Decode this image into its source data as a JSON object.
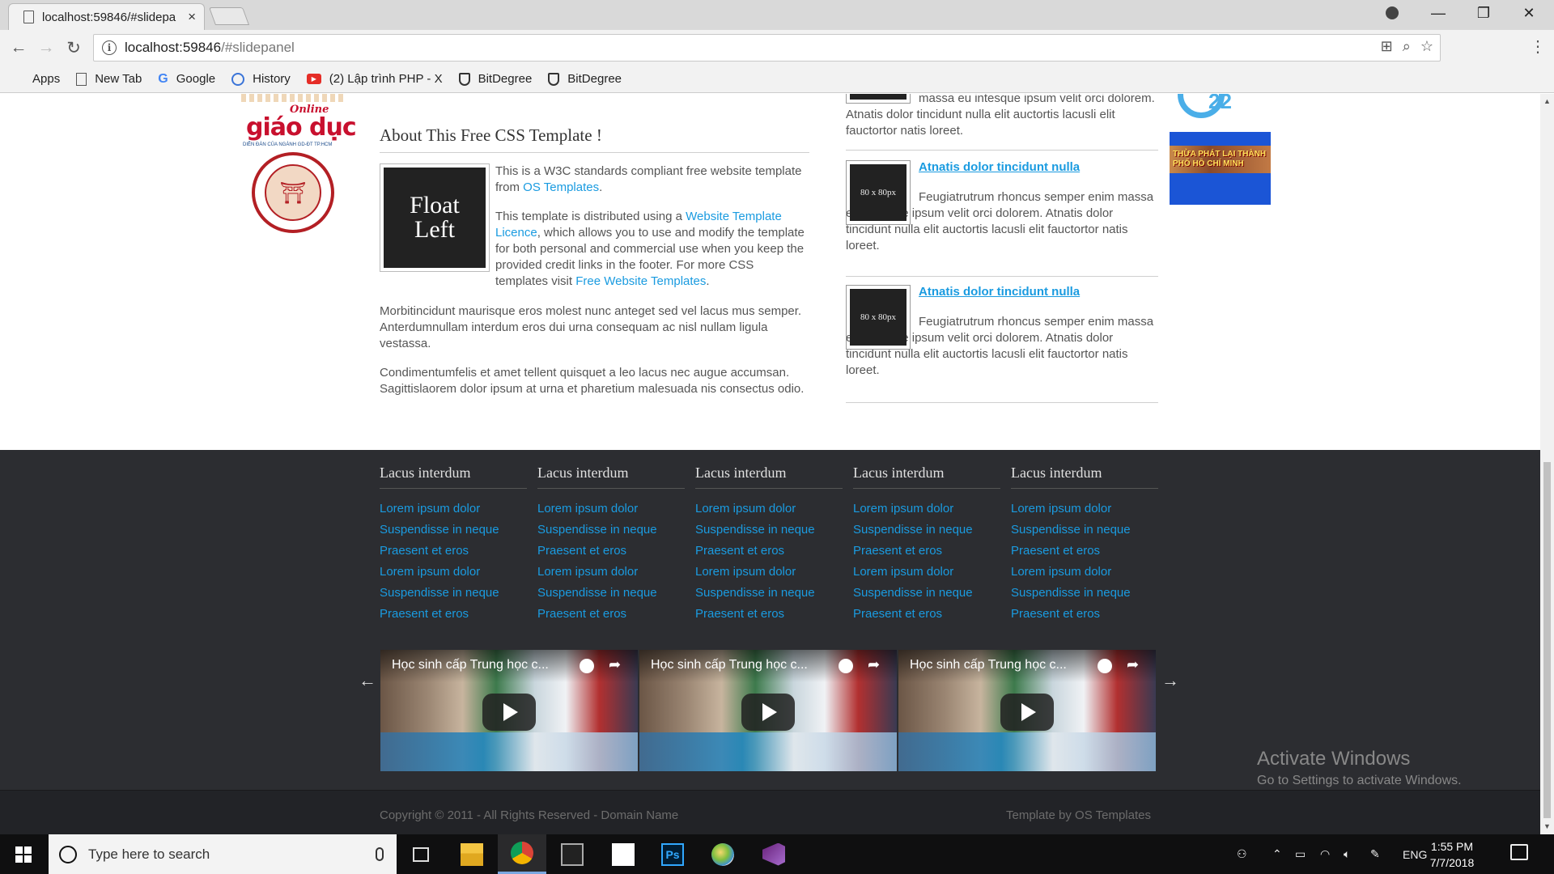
{
  "browser": {
    "tab_title": "localhost:59846/#slidepa",
    "tab_close": "×",
    "url_host": "localhost:59846",
    "url_path": "/#slidepanel",
    "bookmarks": [
      {
        "label": "Apps",
        "icon": "apps-grid-icon"
      },
      {
        "label": "New Tab",
        "icon": "page-icon"
      },
      {
        "label": "Google",
        "icon": "google-icon"
      },
      {
        "label": "History",
        "icon": "history-icon"
      },
      {
        "label": "(2) Lập trình PHP - X",
        "icon": "youtube-icon"
      },
      {
        "label": "BitDegree",
        "icon": "shield-icon"
      },
      {
        "label": "BitDegree",
        "icon": "shield-icon"
      }
    ]
  },
  "logos": {
    "online": "Online",
    "giaoduc": "giáo dục",
    "giaoduc_sub": "DIỄN ĐÀN CỦA NGÀNH GD-ĐT TP.HCM",
    "ad_banner": "THỪA PHÁT LẠI THÀNH PHỐ HỒ CHÍ MINH"
  },
  "article": {
    "heading": "About This Free CSS Template !",
    "float_line1": "Float",
    "float_line2": "Left",
    "intro_text": "This is a W3C standards compliant free website template from ",
    "intro_link": "OS Templates",
    "intro_end": ".",
    "licence_text": "This template is distributed using a ",
    "licence_link": "Website Template Licence",
    "licence_mid": ", which allows you to use and modify the template for both personal and commercial use when you keep the provided credit links in the footer. For more CSS templates visit ",
    "licence_link2": "Free Website Templates",
    "licence_end": ".",
    "para_morbi": "Morbitincidunt maurisque eros molest nunc anteget sed vel lacus mus semper. Anterdumnullam interdum eros dui urna consequam ac nisl nullam ligula vestassa.",
    "para_condi": "Condimentumfelis et amet tellent quisquet a leo lacus nec augue accumsan. Sagittislaorem dolor ipsum at urna et pharetium malesuada nis consectus odio."
  },
  "posts": {
    "top_partial": "massa eu intesque ipsum velit orci dolorem. Atnatis dolor tincidunt nulla elit auctortis lacusli elit fauctortor natis loreet.",
    "items": [
      {
        "thumb": "80 x 80px",
        "title": "Atnatis dolor tincidunt nulla",
        "text": "Feugiatrutrum rhoncus semper enim massa eu intesque ipsum velit orci dolorem. Atnatis dolor tincidunt nulla elit auctortis lacusli elit fauctortor natis loreet."
      },
      {
        "thumb": "80 x 80px",
        "title": "Atnatis dolor tincidunt nulla",
        "text": "Feugiatrutrum rhoncus semper enim massa eu intesque ipsum velit orci dolorem. Atnatis dolor tincidunt nulla elit auctortis lacusli elit fauctortor natis loreet."
      }
    ]
  },
  "footer": {
    "columns": [
      {
        "heading": "Lacus interdum",
        "links": [
          "Lorem ipsum dolor",
          "Suspendisse in neque",
          "Praesent et eros",
          "Lorem ipsum dolor",
          "Suspendisse in neque",
          "Praesent et eros"
        ]
      },
      {
        "heading": "Lacus interdum",
        "links": [
          "Lorem ipsum dolor",
          "Suspendisse in neque",
          "Praesent et eros",
          "Lorem ipsum dolor",
          "Suspendisse in neque",
          "Praesent et eros"
        ]
      },
      {
        "heading": "Lacus interdum",
        "links": [
          "Lorem ipsum dolor",
          "Suspendisse in neque",
          "Praesent et eros",
          "Lorem ipsum dolor",
          "Suspendisse in neque",
          "Praesent et eros"
        ]
      },
      {
        "heading": "Lacus interdum",
        "links": [
          "Lorem ipsum dolor",
          "Suspendisse in neque",
          "Praesent et eros",
          "Lorem ipsum dolor",
          "Suspendisse in neque",
          "Praesent et eros"
        ]
      },
      {
        "heading": "Lacus interdum",
        "links": [
          "Lorem ipsum dolor",
          "Suspendisse in neque",
          "Praesent et eros",
          "Lorem ipsum dolor",
          "Suspendisse in neque",
          "Praesent et eros"
        ]
      }
    ],
    "arrow_prev": "←",
    "arrow_next": "→",
    "videos": [
      {
        "title": "Học sinh cấp Trung học c..."
      },
      {
        "title": "Học sinh cấp Trung học c..."
      },
      {
        "title": "Học sinh cấp Trung học c..."
      }
    ],
    "copyright": "Copyright © 2011 - All Rights Reserved - Domain Name",
    "credit": "Template by OS Templates"
  },
  "watermark": {
    "line1": "Activate Windows",
    "line2": "Go to Settings to activate Windows."
  },
  "taskbar": {
    "search_placeholder": "Type here to search",
    "language": "ENG",
    "time": "1:55 PM",
    "date": "7/7/2018"
  },
  "colors": {
    "link": "#1a9be0",
    "footer_bg": "#2c2d31",
    "copyright_bg": "#222327"
  }
}
